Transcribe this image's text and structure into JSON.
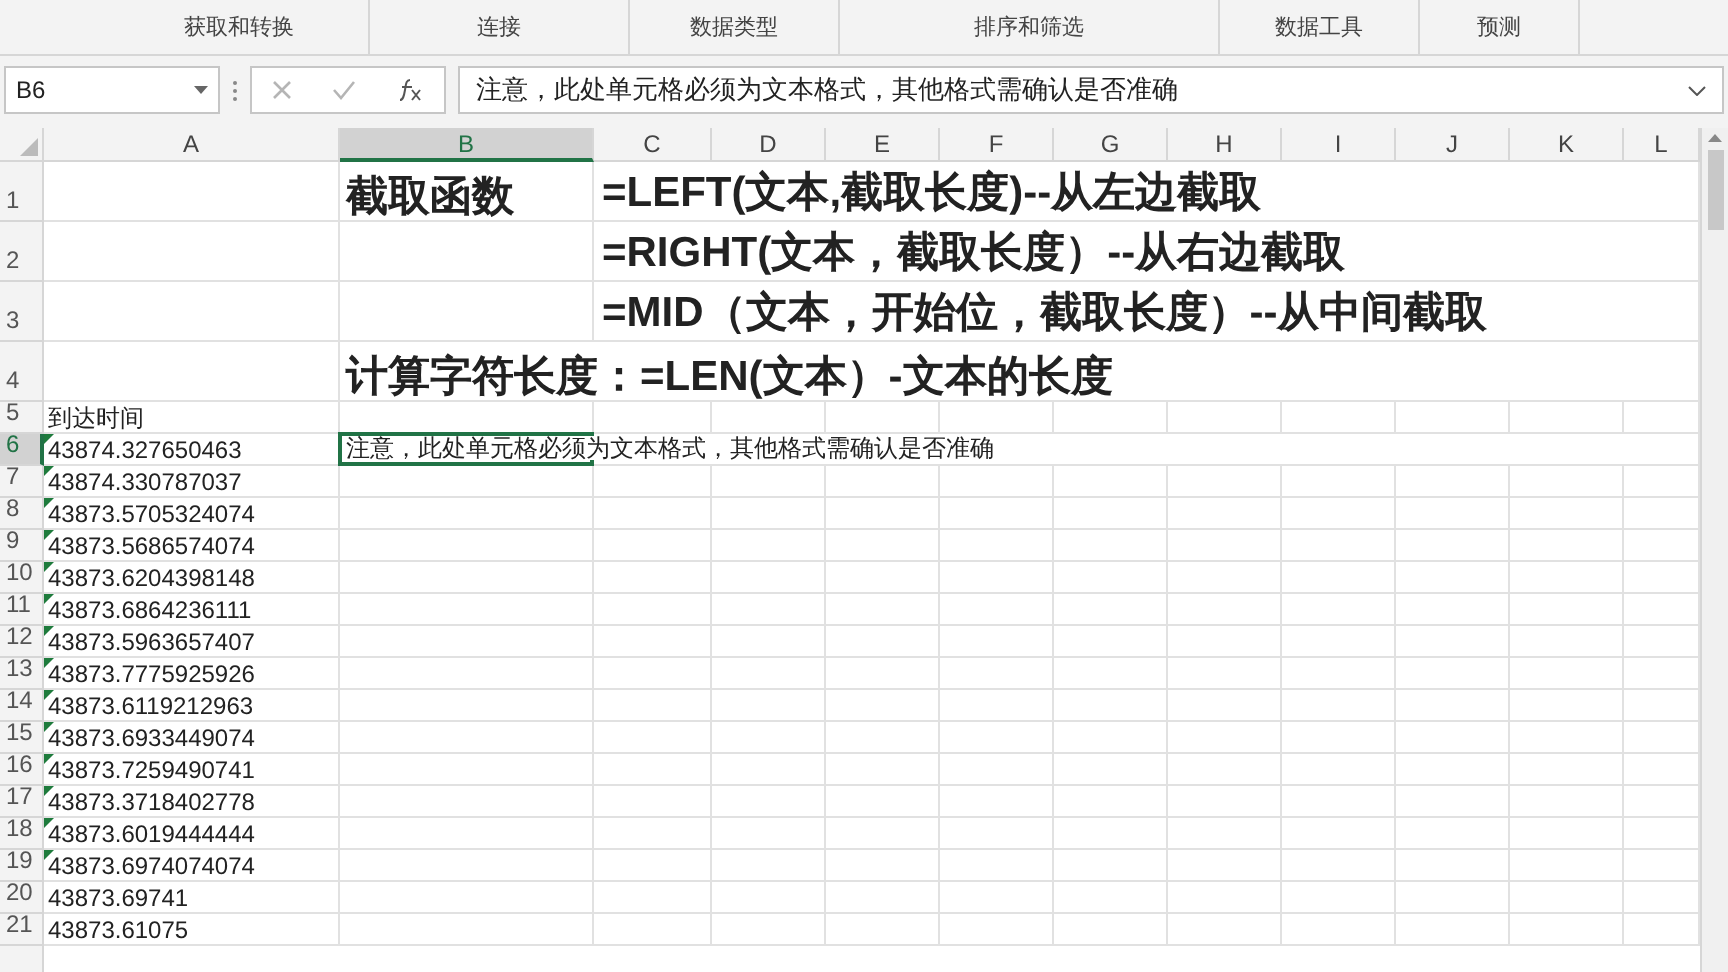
{
  "ribbon": {
    "groups": [
      "获取和转换",
      "连接",
      "数据类型",
      "排序和筛选",
      "数据工具",
      "预测"
    ]
  },
  "name_box": {
    "value": "B6"
  },
  "formula_bar": {
    "value": "注意，此处单元格必须为文本格式，其他格式需确认是否准确"
  },
  "columns": [
    {
      "label": "A",
      "selected": false
    },
    {
      "label": "B",
      "selected": true
    },
    {
      "label": "C",
      "selected": false
    },
    {
      "label": "D",
      "selected": false
    },
    {
      "label": "E",
      "selected": false
    },
    {
      "label": "F",
      "selected": false
    },
    {
      "label": "G",
      "selected": false
    },
    {
      "label": "H",
      "selected": false
    },
    {
      "label": "I",
      "selected": false
    },
    {
      "label": "J",
      "selected": false
    },
    {
      "label": "K",
      "selected": false
    },
    {
      "label": "L",
      "selected": false
    }
  ],
  "rows": [
    {
      "number": "1",
      "selected": false,
      "kind": "heading",
      "col_b": {
        "text": "截取函数",
        "active": false
      },
      "col_c": {
        "text": "=LEFT(文本,截取长度)--从左边截取"
      }
    },
    {
      "number": "2",
      "selected": false,
      "kind": "heading",
      "col_c": {
        "text": "=RIGHT(文本，截取长度）--从右边截取"
      }
    },
    {
      "number": "3",
      "selected": false,
      "kind": "heading",
      "col_c": {
        "text": "=MID（文本，开始位，截取长度）--从中间截取"
      }
    },
    {
      "number": "4",
      "selected": false,
      "kind": "heading",
      "col_b": {
        "text": "计算字符长度：=LEN(文本）-文本的长度",
        "active": false
      }
    },
    {
      "number": "5",
      "selected": false,
      "kind": "data",
      "col_a": {
        "text": "到达时间",
        "flag": false
      }
    },
    {
      "number": "6",
      "selected": true,
      "kind": "data",
      "col_a": {
        "text": "43874.327650463",
        "flag": true
      },
      "col_b": {
        "text": "注意，此处单元格必须为文本格式，其他格式需确认是否准确",
        "active": true
      }
    },
    {
      "number": "7",
      "selected": false,
      "kind": "data",
      "col_a": {
        "text": "43874.330787037",
        "flag": true
      }
    },
    {
      "number": "8",
      "selected": false,
      "kind": "data",
      "col_a": {
        "text": "43873.5705324074",
        "flag": true
      }
    },
    {
      "number": "9",
      "selected": false,
      "kind": "data",
      "col_a": {
        "text": "43873.5686574074",
        "flag": true
      }
    },
    {
      "number": "10",
      "selected": false,
      "kind": "data",
      "col_a": {
        "text": "43873.6204398148",
        "flag": true
      }
    },
    {
      "number": "11",
      "selected": false,
      "kind": "data",
      "col_a": {
        "text": "43873.6864236111",
        "flag": true
      }
    },
    {
      "number": "12",
      "selected": false,
      "kind": "data",
      "col_a": {
        "text": "43873.5963657407",
        "flag": true
      }
    },
    {
      "number": "13",
      "selected": false,
      "kind": "data",
      "col_a": {
        "text": "43873.7775925926",
        "flag": true
      }
    },
    {
      "number": "14",
      "selected": false,
      "kind": "data",
      "col_a": {
        "text": "43873.6119212963",
        "flag": true
      }
    },
    {
      "number": "15",
      "selected": false,
      "kind": "data",
      "col_a": {
        "text": "43873.6933449074",
        "flag": true
      }
    },
    {
      "number": "16",
      "selected": false,
      "kind": "data",
      "col_a": {
        "text": "43873.7259490741",
        "flag": true
      }
    },
    {
      "number": "17",
      "selected": false,
      "kind": "data",
      "col_a": {
        "text": "43873.3718402778",
        "flag": true
      }
    },
    {
      "number": "18",
      "selected": false,
      "kind": "data",
      "col_a": {
        "text": "43873.6019444444",
        "flag": true
      }
    },
    {
      "number": "19",
      "selected": false,
      "kind": "data",
      "col_a": {
        "text": "43873.6974074074",
        "flag": true
      }
    },
    {
      "number": "20",
      "selected": false,
      "kind": "data",
      "col_a": {
        "text": "43873.69741",
        "flag": false
      }
    },
    {
      "number": "21",
      "selected": false,
      "kind": "data",
      "col_a": {
        "text": "43873.61075",
        "flag": false
      }
    }
  ]
}
